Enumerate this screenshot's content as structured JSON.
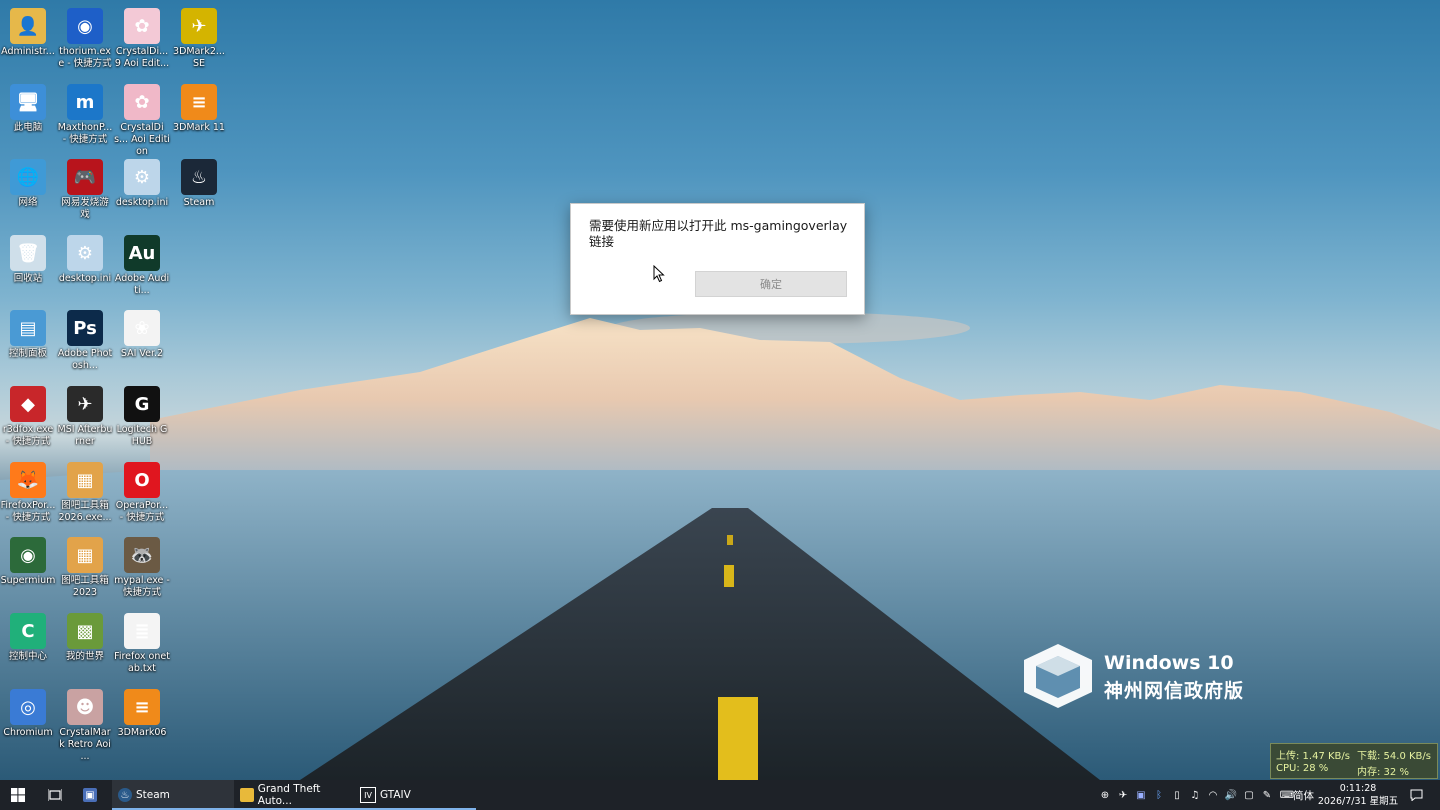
{
  "desktop_icons": [
    {
      "label": "Administr...",
      "icon": "user-folder-icon",
      "color": "#e6b84a",
      "glyph": "👤"
    },
    {
      "label": "thorium.exe - 快捷方式",
      "icon": "thorium-icon",
      "color": "#1e5fc8",
      "glyph": "◉"
    },
    {
      "label": "CrystalDi... 9 Aoi Edit...",
      "icon": "crystaldisk-aoi-icon",
      "color": "#f3c9d6",
      "glyph": "✿"
    },
    {
      "label": "3DMark2... SE",
      "icon": "3dmark-se-icon",
      "color": "#d4b400",
      "glyph": "✈"
    },
    {
      "label": "此电脑",
      "icon": "this-pc-icon",
      "color": "#3d8fd8",
      "glyph": "🖥"
    },
    {
      "label": "MaxthonP... - 快捷方式",
      "icon": "maxthon-icon",
      "color": "#1c77c9",
      "glyph": "m"
    },
    {
      "label": "CrystalDis... Aoi Edition",
      "icon": "crystaldisk-aoi-edition-icon",
      "color": "#f0b8c8",
      "glyph": "✿"
    },
    {
      "label": "3DMark 11",
      "icon": "3dmark-11-icon",
      "color": "#f08a1a",
      "glyph": "≡"
    },
    {
      "label": "网络",
      "icon": "network-icon",
      "color": "#3f9ad6",
      "glyph": "🌐"
    },
    {
      "label": "网易发烧游戏",
      "icon": "netease-game-icon",
      "color": "#b8141c",
      "glyph": "🎮"
    },
    {
      "label": "desktop.ini",
      "icon": "ini-file-icon",
      "color": "#bdd6ea",
      "glyph": "⚙"
    },
    {
      "label": "Steam",
      "icon": "steam-icon",
      "color": "#1b2838",
      "glyph": "♨"
    },
    {
      "label": "回收站",
      "icon": "recycle-bin-icon",
      "color": "#cfdfea",
      "glyph": "🗑"
    },
    {
      "label": "desktop.ini",
      "icon": "ini-file-icon",
      "color": "#bdd6ea",
      "glyph": "⚙"
    },
    {
      "label": "Adobe Auditi...",
      "icon": "adobe-audition-icon",
      "color": "#103a2a",
      "glyph": "Au"
    },
    {
      "label": "控制面板",
      "icon": "control-panel-icon",
      "color": "#4a9ad4",
      "glyph": "▤"
    },
    {
      "label": "Adobe Photosh...",
      "icon": "adobe-photoshop-icon",
      "color": "#0c2a4a",
      "glyph": "Ps"
    },
    {
      "label": "SAI Ver.2",
      "icon": "sai-icon",
      "color": "#f3f3f3",
      "glyph": "❀"
    },
    {
      "label": "r3dfox.exe - 快捷方式",
      "icon": "r3dfox-icon",
      "color": "#c8262a",
      "glyph": "◆"
    },
    {
      "label": "MSI Afterburner",
      "icon": "msi-afterburner-icon",
      "color": "#2a2a2a",
      "glyph": "✈"
    },
    {
      "label": "Logitech G HUB",
      "icon": "logitech-ghub-icon",
      "color": "#111111",
      "glyph": "G"
    },
    {
      "label": "FirefoxPor... - 快捷方式",
      "icon": "firefox-icon",
      "color": "#ff7a1a",
      "glyph": "🦊"
    },
    {
      "label": "图吧工具箱 2026.exe...",
      "icon": "tuba-toolbox-icon",
      "color": "#e2a34a",
      "glyph": "▦"
    },
    {
      "label": "OperaPor... - 快捷方式",
      "icon": "opera-icon",
      "color": "#e0161f",
      "glyph": "O"
    },
    {
      "label": "Supermium",
      "icon": "supermium-icon",
      "color": "#2c6a3a",
      "glyph": "◉"
    },
    {
      "label": "图吧工具箱 2023",
      "icon": "tuba-toolbox-2023-icon",
      "color": "#e2a34a",
      "glyph": "▦"
    },
    {
      "label": "mypal.exe - 快捷方式",
      "icon": "mypal-icon",
      "color": "#6b5a44",
      "glyph": "🦝"
    },
    {
      "label": "控制中心",
      "icon": "control-center-icon",
      "color": "#20b07a",
      "glyph": "C"
    },
    {
      "label": "我的世界",
      "icon": "minecraft-icon",
      "color": "#6a9a3a",
      "glyph": "▩"
    },
    {
      "label": "Firefox onetab.txt",
      "icon": "text-file-icon",
      "color": "#f4f4f4",
      "glyph": "≣"
    },
    {
      "label": "Chromium",
      "icon": "chromium-icon",
      "color": "#3a7bd5",
      "glyph": "◎"
    },
    {
      "label": "CrystalMark Retro Aoi ...",
      "icon": "crystalmark-retro-icon",
      "color": "#c9a2a2",
      "glyph": "☻"
    },
    {
      "label": "3DMark06",
      "icon": "3dmark06-icon",
      "color": "#f08a1a",
      "glyph": "≡"
    }
  ],
  "dialog": {
    "message": "需要使用新应用以打开此 ms-gamingoverlay 链接",
    "ok_label": "确定"
  },
  "brand": {
    "line1": "Windows 10",
    "line2": "神州网信政府版"
  },
  "net_monitor": {
    "upload": "上传: 1.47 KB/s",
    "download": "下载: 54.0 KB/s",
    "cpu": "CPU: 28 %",
    "memory": "内存: 32 %"
  },
  "taskbar": {
    "items": [
      {
        "label": "Steam",
        "icon": "steam-icon"
      },
      {
        "label": "Grand Theft Auto...",
        "icon": "folder-icon"
      },
      {
        "label": "GTAIV",
        "icon": "gtaiv-icon"
      }
    ],
    "ime": "简体",
    "time": "0:11:28",
    "date": "2026/7/31 星期五"
  }
}
